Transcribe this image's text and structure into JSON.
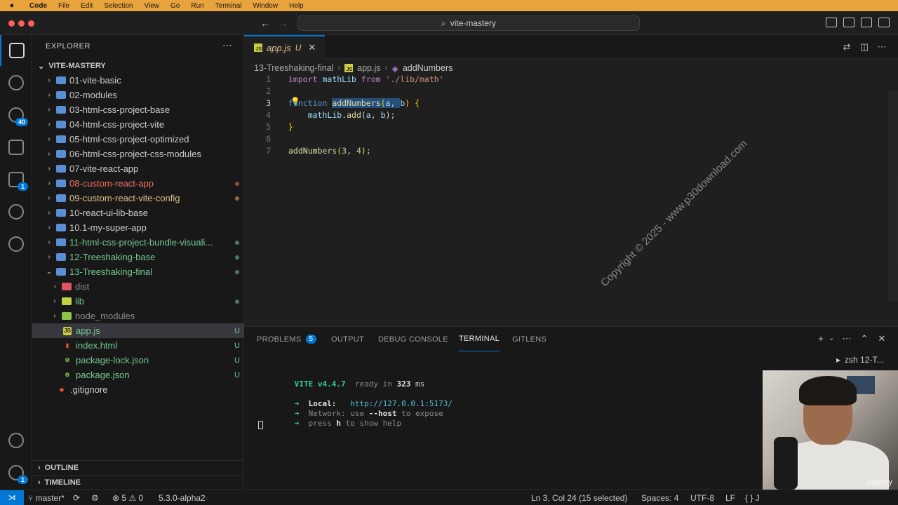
{
  "menubar": {
    "items": [
      "Code",
      "File",
      "Edit",
      "Selection",
      "View",
      "Go",
      "Run",
      "Terminal",
      "Window",
      "Help"
    ]
  },
  "titlebar": {
    "search_text": "vite-mastery"
  },
  "activity": {
    "scm_badge": "40",
    "extensions_badge": "1",
    "settings_badge": "1"
  },
  "sidebar": {
    "title": "EXPLORER",
    "workspace": "VITE-MASTERY",
    "tree": [
      {
        "label": "01-vite-basic",
        "type": "folder",
        "depth": 0,
        "color": "#cccccc",
        "status": ""
      },
      {
        "label": "02-modules",
        "type": "folder",
        "depth": 0,
        "color": "#cccccc",
        "status": ""
      },
      {
        "label": "03-html-css-project-base",
        "type": "folder",
        "depth": 0,
        "color": "#cccccc",
        "status": ""
      },
      {
        "label": "04-html-css-project-vite",
        "type": "folder",
        "depth": 0,
        "color": "#cccccc",
        "status": ""
      },
      {
        "label": "05-html-css-project-optimized",
        "type": "folder",
        "depth": 0,
        "color": "#cccccc",
        "status": ""
      },
      {
        "label": "06-html-css-project-css-modules",
        "type": "folder",
        "depth": 0,
        "color": "#cccccc",
        "status": ""
      },
      {
        "label": "07-vite-react-app",
        "type": "folder",
        "depth": 0,
        "color": "#cccccc",
        "status": ""
      },
      {
        "label": "08-custom-react-app",
        "type": "folder",
        "depth": 0,
        "color": "#f1715f",
        "status": "dot-red"
      },
      {
        "label": "09-custom-react-vite-config",
        "type": "folder",
        "depth": 0,
        "color": "#e2c08d",
        "status": "dot-brown"
      },
      {
        "label": "10-react-ui-lib-base",
        "type": "folder",
        "depth": 0,
        "color": "#cccccc",
        "status": ""
      },
      {
        "label": "10.1-my-super-app",
        "type": "folder",
        "depth": 0,
        "color": "#cccccc",
        "status": ""
      },
      {
        "label": "11-html-css-project-bundle-visuali...",
        "type": "folder",
        "depth": 0,
        "color": "#73c991",
        "status": "dot-green"
      },
      {
        "label": "12-Treeshaking-base",
        "type": "folder",
        "depth": 0,
        "color": "#73c991",
        "status": "dot-green"
      },
      {
        "label": "13-Treeshaking-final",
        "type": "folder-open",
        "depth": 0,
        "color": "#73c991",
        "status": "dot-green"
      },
      {
        "label": "dist",
        "type": "folder",
        "depth": 1,
        "color": "#8c8c8c",
        "status": ""
      },
      {
        "label": "lib",
        "type": "folder",
        "depth": 1,
        "color": "#73c991",
        "status": "dot-green"
      },
      {
        "label": "node_modules",
        "type": "folder",
        "depth": 1,
        "color": "#8c8c8c",
        "status": ""
      },
      {
        "label": "app.js",
        "type": "file-js",
        "depth": 1,
        "color": "#73c991",
        "status": "U",
        "selected": true
      },
      {
        "label": "index.html",
        "type": "file-html",
        "depth": 1,
        "color": "#73c991",
        "status": "U"
      },
      {
        "label": "package-lock.json",
        "type": "file-json",
        "depth": 1,
        "color": "#73c991",
        "status": "U"
      },
      {
        "label": "package.json",
        "type": "file-json",
        "depth": 1,
        "color": "#73c991",
        "status": "U"
      },
      {
        "label": ".gitignore",
        "type": "file-git",
        "depth": 0,
        "color": "#cccccc",
        "status": ""
      }
    ],
    "outline": "OUTLINE",
    "timeline": "TIMELINE"
  },
  "editor": {
    "tab": {
      "name": "app.js",
      "status": "U",
      "close": "✕"
    },
    "breadcrumbs": {
      "folder": "13-Treeshaking-final",
      "file": "app.js",
      "symbol": "addNumbers"
    },
    "watermark": "Copyright © 2025 - www.p30download.com"
  },
  "panel": {
    "tabs": [
      {
        "label": "PROBLEMS",
        "badge": "5"
      },
      {
        "label": "OUTPUT"
      },
      {
        "label": "DEBUG CONSOLE"
      },
      {
        "label": "TERMINAL",
        "active": true
      },
      {
        "label": "GITLENS"
      }
    ],
    "terminal_instance": "zsh  12-T...",
    "terminal": {
      "vite": "VITE v4.4.7",
      "ready": "ready in",
      "ms": "323",
      "ms_unit": "ms",
      "local_label": "Local:",
      "local_url": "http://127.0.0.1:5173/",
      "network_label": "Network:",
      "network_use": "use",
      "network_host": "--host",
      "network_tail": "to expose",
      "press": "press",
      "press_key": "h",
      "press_tail": "to show help"
    },
    "webcam_watermark": "udemy"
  },
  "statusbar": {
    "branch": "master*",
    "errors": "5",
    "warnings": "0",
    "version": "5.3.0-alpha2",
    "position": "Ln 3, Col 24 (15 selected)",
    "spaces": "Spaces: 4",
    "encoding": "UTF-8",
    "eol": "LF",
    "language": "{ }  J"
  },
  "colors": {
    "accent": "#0078d4",
    "menubar": "#e8a33c",
    "untracked": "#73c991",
    "modified": "#e2c08d",
    "error": "#f1715f"
  }
}
